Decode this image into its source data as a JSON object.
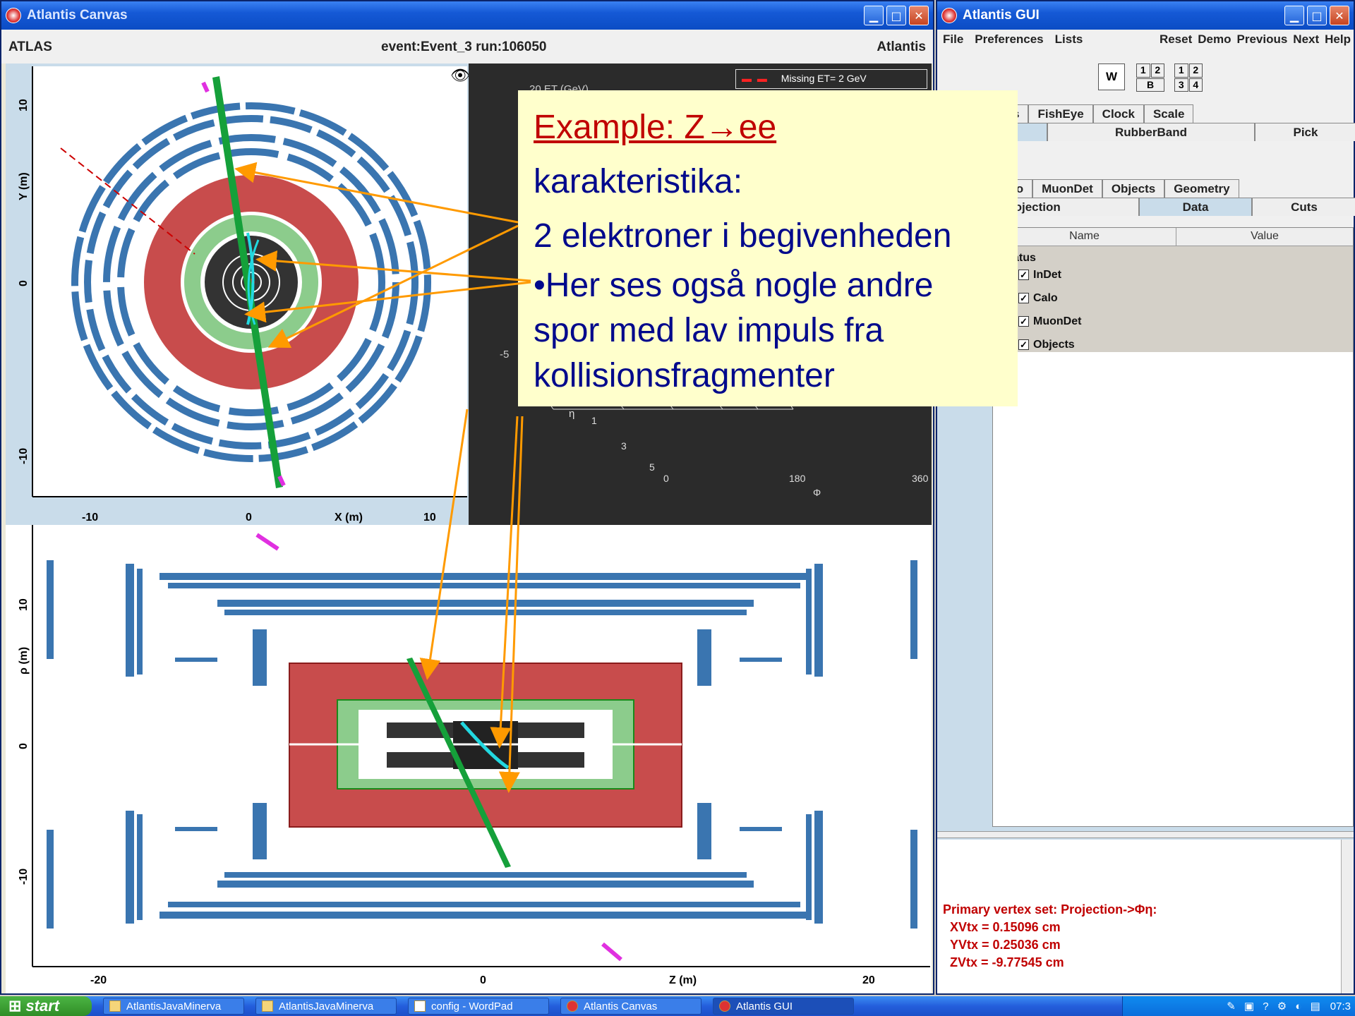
{
  "canvas_window": {
    "title": "Atlantis Canvas",
    "header_left": "ATLAS",
    "header_center": "event:Event_3 run:106050",
    "header_right": "Atlantis",
    "xy_view": {
      "x_ticks": [
        "-10",
        "0",
        "10"
      ],
      "x_label": "X (m)",
      "y_ticks": [
        "10",
        "0",
        "-10"
      ],
      "y_label": "Y (m)"
    },
    "lego_view": {
      "legend": "Missing ET= 2 GeV",
      "z_label": "20 ET (GeV)",
      "eta_label": "η",
      "eta_ticks": [
        "1",
        "3",
        "5"
      ],
      "phi_label": "Φ",
      "phi_ticks": [
        "0",
        "180",
        "360"
      ],
      "side_tick": "-5"
    },
    "rz_view": {
      "x_ticks": [
        "-20",
        "0",
        "20"
      ],
      "x_label": "Z (m)",
      "y_ticks": [
        "10",
        "0",
        "-10"
      ],
      "y_label": "ρ (m)"
    }
  },
  "gui_window": {
    "title": "Atlantis GUI",
    "menu": [
      "File",
      "Preferences",
      "Lists",
      "Reset",
      "Demo",
      "Previous",
      "Next",
      "Help"
    ],
    "layout_buttons": {
      "w": "W",
      "grid_a": [
        "1",
        "2",
        "B"
      ],
      "grid_b": [
        "1",
        "2",
        "3",
        "4"
      ]
    },
    "tabs_row1": [
      "s",
      "FishEye",
      "Clock",
      "Scale"
    ],
    "tabs_row2": [
      "",
      "RubberBand",
      "Pick"
    ],
    "tabs_row3": [
      "lo",
      "MuonDet",
      "Objects",
      "Geometry"
    ],
    "tabs_row4": [
      "rojection",
      "Data",
      "Cuts"
    ],
    "table_headers": {
      "name": "Name",
      "value": "Value"
    },
    "tree_root": "Status",
    "tree_items": [
      "InDet",
      "Calo",
      "MuonDet",
      "Objects"
    ],
    "status_lines": [
      "Primary vertex set: Projection->Φη:",
      "XVtx = 0.15096 cm",
      "YVtx = 0.25036 cm",
      "ZVtx = -9.77545 cm"
    ]
  },
  "overlay": {
    "title": "Example: Z→ee",
    "line1": "karakteristika:",
    "line2": "2 elektroner i begivenheden",
    "line3a": "•Her ses også nogle andre",
    "line3b": "spor med lav impuls fra",
    "line3c": "kollisionsfragmenter"
  },
  "taskbar": {
    "start": "start",
    "items": [
      "AtlantisJavaMinerva",
      "AtlantisJavaMinerva",
      "config - WordPad",
      "Atlantis Canvas",
      "Atlantis GUI"
    ],
    "clock": "07:3"
  },
  "colors": {
    "titlebar": "#0b4cc4",
    "muon": "#3a75b0",
    "calo_red": "#c84c4c",
    "calo_green": "#8ccc8c",
    "electron": "#15a03a",
    "track_cyan": "#22d8e0",
    "arrow": "#ff9a00",
    "overlay_bg": "#ffffcc",
    "overlay_text": "#00098c",
    "overlay_title": "#c00000"
  }
}
